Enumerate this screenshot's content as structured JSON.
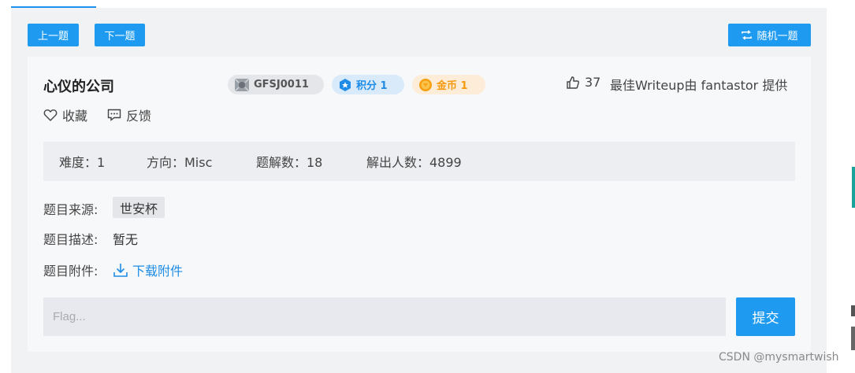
{
  "nav": {
    "prev_label": "上一题",
    "next_label": "下一题",
    "random_label": "随机一题"
  },
  "challenge": {
    "title": "心仪的公司",
    "id": "GFSJ0011",
    "score_label": "积分 1",
    "coin_label": "金币 1",
    "likes": "37",
    "writeup_text": "最佳Writeup由 fantastor 提供",
    "favorite_label": "收藏",
    "feedback_label": "反馈"
  },
  "stats": {
    "difficulty": "难度：1",
    "direction": "方向：Misc",
    "solutions": "题解数：18",
    "solved": "解出人数：4899"
  },
  "info": {
    "source_label": "题目来源:",
    "source_value": "世安杯",
    "desc_label": "题目描述:",
    "desc_value": "暂无",
    "attachment_label": "题目附件:",
    "download_label": "下载附件"
  },
  "flag": {
    "placeholder": "Flag...",
    "submit_label": "提交"
  },
  "watermark": "CSDN @mysmartwish",
  "colors": {
    "primary": "#1e9bf0",
    "score_badge": "#1e8ce6",
    "coin_badge": "#f59a0f"
  },
  "icons": [
    "random-icon",
    "id-badge-icon",
    "score-star-icon",
    "coin-icon",
    "thumbs-up-icon",
    "heart-icon",
    "feedback-icon",
    "download-icon"
  ]
}
